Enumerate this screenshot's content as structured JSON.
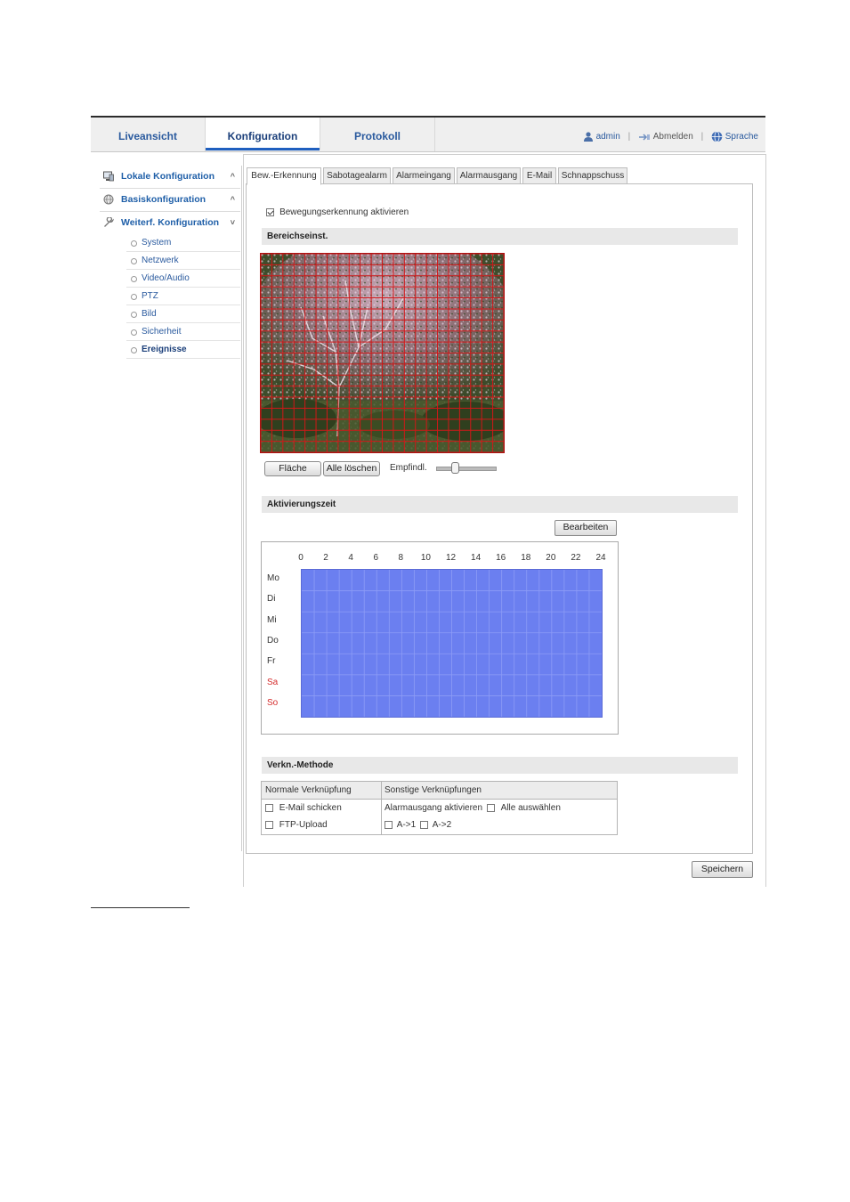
{
  "nav": {
    "tabs": [
      "Liveansicht",
      "Konfiguration",
      "Protokoll"
    ],
    "active_tab": "Konfiguration",
    "user": "admin",
    "logout": "Abmelden",
    "language": "Sprache"
  },
  "sidebar": {
    "sections": [
      {
        "label": "Lokale Konfiguration",
        "icon": "monitor-icon",
        "chevron": "^"
      },
      {
        "label": "Basiskonfiguration",
        "icon": "globe-icon",
        "chevron": "^"
      },
      {
        "label": "Weiterf. Konfiguration",
        "icon": "wrench-icon",
        "chevron": "˅"
      }
    ],
    "subitems": [
      "System",
      "Netzwerk",
      "Video/Audio",
      "PTZ",
      "Bild",
      "Sicherheit",
      "Ereignisse"
    ],
    "active_subitem": "Ereignisse"
  },
  "tabs": [
    "Bew.-Erkennung",
    "Sabotagealarm",
    "Alarmeingang",
    "Alarmausgang",
    "E-Mail",
    "Schnappschuss"
  ],
  "active_tab_index": 0,
  "motion": {
    "enable_label": "Bewegungserkennung aktivieren",
    "enabled": true,
    "area_section_title": "Bereichseinst.",
    "area_button": "Fläche",
    "clear_button": "Alle löschen",
    "sensitivity_label": "Empfindl.",
    "sensitivity_fraction": 0.32,
    "grid_color": "#d01818"
  },
  "schedule": {
    "section_title": "Aktivierungszeit",
    "edit_button": "Bearbeiten",
    "hours": [
      "0",
      "2",
      "4",
      "6",
      "8",
      "10",
      "12",
      "14",
      "16",
      "18",
      "20",
      "22",
      "24"
    ],
    "days": [
      "Mo",
      "Di",
      "Mi",
      "Do",
      "Fr",
      "Sa",
      "So"
    ],
    "weekend_days": [
      "Sa",
      "So"
    ],
    "fill_color": "#6b7ff0"
  },
  "linking": {
    "section_title": "Verkn.-Methode",
    "col_normal": "Normale Verknüpfung",
    "col_other": "Sonstige Verknüpfungen",
    "email": "E-Mail schicken",
    "ftp": "FTP-Upload",
    "alarm_out": "Alarmausgang aktivieren",
    "select_all": "Alle auswählen",
    "out1": "A->1",
    "out2": "A->2"
  },
  "save_button": "Speichern"
}
